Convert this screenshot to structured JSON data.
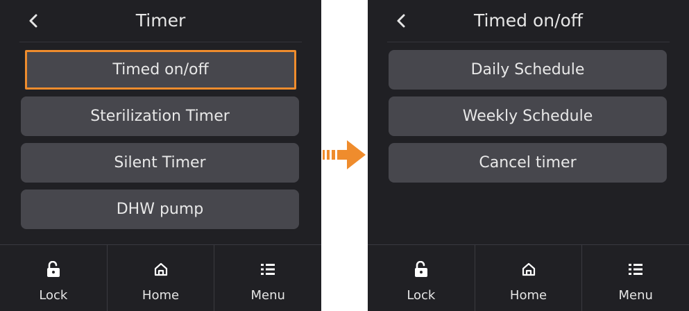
{
  "left_screen": {
    "title": "Timer",
    "items": [
      {
        "label": "Timed on/off",
        "selected": true
      },
      {
        "label": "Sterilization Timer",
        "selected": false
      },
      {
        "label": "Silent Timer",
        "selected": false
      },
      {
        "label": "DHW pump",
        "selected": false
      }
    ]
  },
  "right_screen": {
    "title": "Timed on/off",
    "items": [
      {
        "label": "Daily Schedule"
      },
      {
        "label": "Weekly Schedule"
      },
      {
        "label": "Cancel timer"
      }
    ]
  },
  "bottom_bar": {
    "lock": {
      "label": "Lock",
      "icon": "lock-open-icon"
    },
    "home": {
      "label": "Home",
      "icon": "home-icon"
    },
    "menu": {
      "label": "Menu",
      "icon": "menu-list-icon"
    }
  },
  "colors": {
    "screen_bg": "#202024",
    "button_bg": "#47474d",
    "highlight": "#ef8c2d",
    "text": "#e8e8e8"
  }
}
